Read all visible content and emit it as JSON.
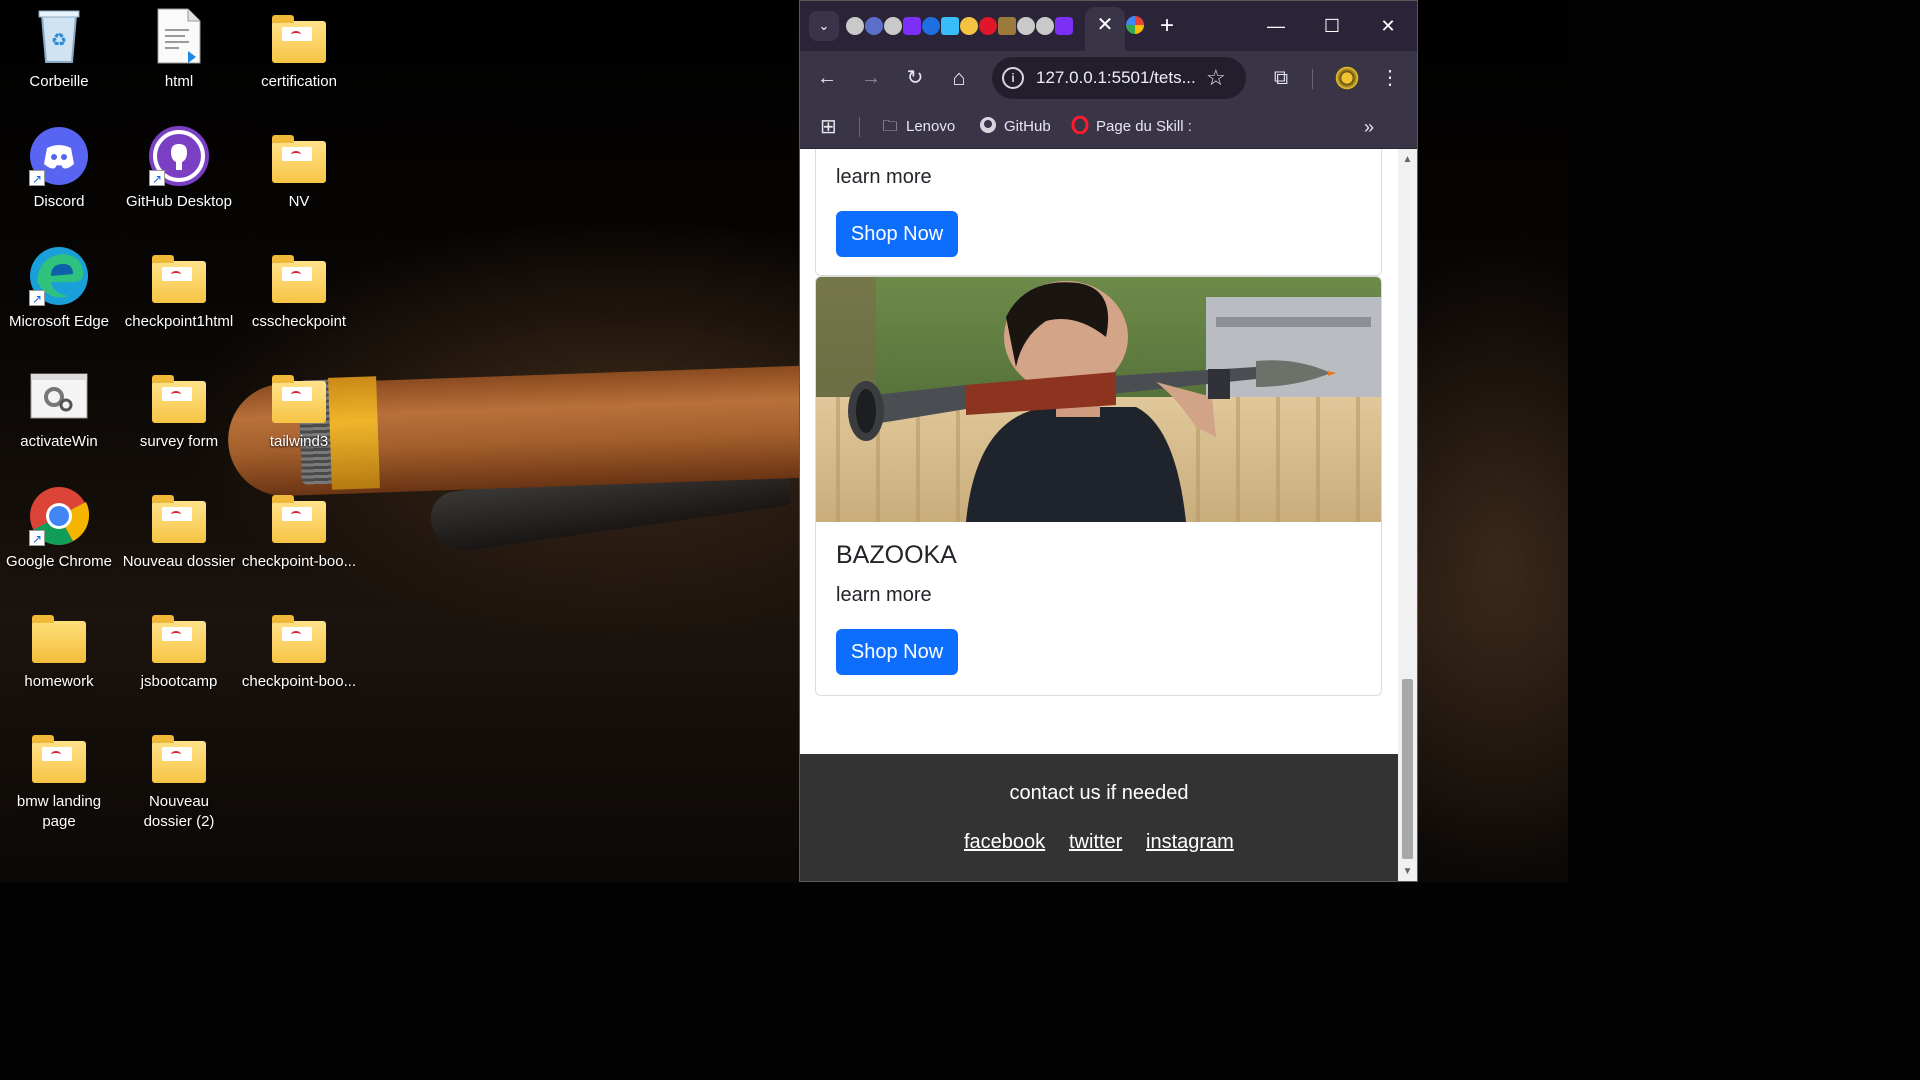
{
  "desktop": {
    "icons": [
      {
        "label": "Corbeille",
        "icon": "recycle-bin-icon"
      },
      {
        "label": "html",
        "icon": "vscode-file-icon"
      },
      {
        "label": "certification",
        "icon": "folder-icon"
      },
      {
        "label": "Discord",
        "icon": "discord-icon"
      },
      {
        "label": "GitHub Desktop",
        "icon": "github-desktop-icon"
      },
      {
        "label": "NV",
        "icon": "folder-icon"
      },
      {
        "label": "Microsoft Edge",
        "icon": "edge-icon"
      },
      {
        "label": "checkpoint1html",
        "icon": "folder-icon"
      },
      {
        "label": "csscheckpoint",
        "icon": "folder-icon"
      },
      {
        "label": "activateWin",
        "icon": "settings-shortcut-icon"
      },
      {
        "label": "survey form",
        "icon": "folder-icon"
      },
      {
        "label": "tailwind3",
        "icon": "folder-icon"
      },
      {
        "label": "Google Chrome",
        "icon": "chrome-icon"
      },
      {
        "label": "Nouveau dossier",
        "icon": "folder-icon"
      },
      {
        "label": "checkpoint-boo...",
        "icon": "folder-icon"
      },
      {
        "label": "homework",
        "icon": "folder-icon"
      },
      {
        "label": "jsbootcamp",
        "icon": "folder-icon"
      },
      {
        "label": "checkpoint-boo...",
        "icon": "folder-icon"
      },
      {
        "label": "bmw landing page",
        "icon": "folder-icon"
      },
      {
        "label": "Nouveau dossier (2)",
        "icon": "folder-icon"
      }
    ]
  },
  "browser": {
    "tab_strip": {
      "close_tab_glyph": "✕",
      "new_tab_glyph": "+",
      "tab_search_glyph": "⌄"
    },
    "window_controls": {
      "minimize": "—",
      "maximize": "☐",
      "close": "✕"
    },
    "toolbar": {
      "back": "←",
      "forward": "→",
      "reload": "↻",
      "home": "⌂",
      "url": "127.0.0.1:5501/tets...",
      "site_info": "i",
      "bookmark_star": "☆",
      "extensions": "⧉",
      "menu": "⋮"
    },
    "bookmarks": [
      {
        "label": "Lenovo",
        "icon": "folder-icon"
      },
      {
        "label": "GitHub",
        "icon": "github-icon"
      },
      {
        "label": "Page du Skill :",
        "icon": "opera-icon"
      }
    ],
    "bookmarks_overflow": "»",
    "apps_glyph": "⊞"
  },
  "page": {
    "card_top": {
      "text": "learn more",
      "button": "Shop Now"
    },
    "card_bazooka": {
      "title": "BAZOOKA",
      "text": "learn more",
      "button": "Shop Now"
    },
    "footer": {
      "title": "contact us if needed",
      "links": [
        "facebook",
        "twitter",
        "instagram"
      ]
    }
  },
  "scrollbar": {
    "up": "▲",
    "down": "▼"
  },
  "colors": {
    "primary_button": "#0d6efd",
    "footer_bg": "#333333",
    "browser_frame": "#3a3447",
    "tab_strip": "#2b2438"
  }
}
